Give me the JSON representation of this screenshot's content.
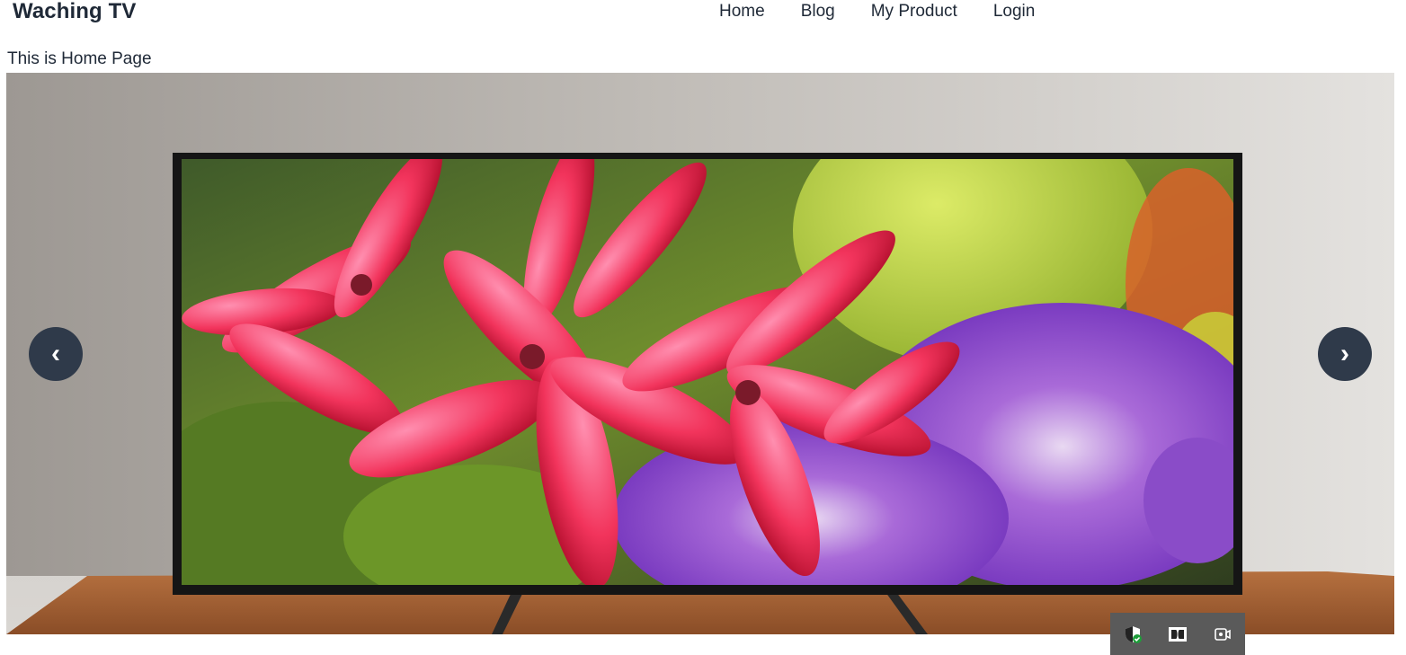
{
  "header": {
    "brand": "Waching TV",
    "nav": [
      {
        "label": "Home"
      },
      {
        "label": "Blog"
      },
      {
        "label": "My Product"
      },
      {
        "label": "Login"
      }
    ]
  },
  "main": {
    "page_title": "This is Home Page",
    "carousel": {
      "prev_label": "‹",
      "next_label": "›",
      "slide_icon": "tv-flowers-photo"
    }
  },
  "taskbar": {
    "icons": [
      "security-shield-icon",
      "dolby-icon",
      "camera-icon"
    ]
  }
}
